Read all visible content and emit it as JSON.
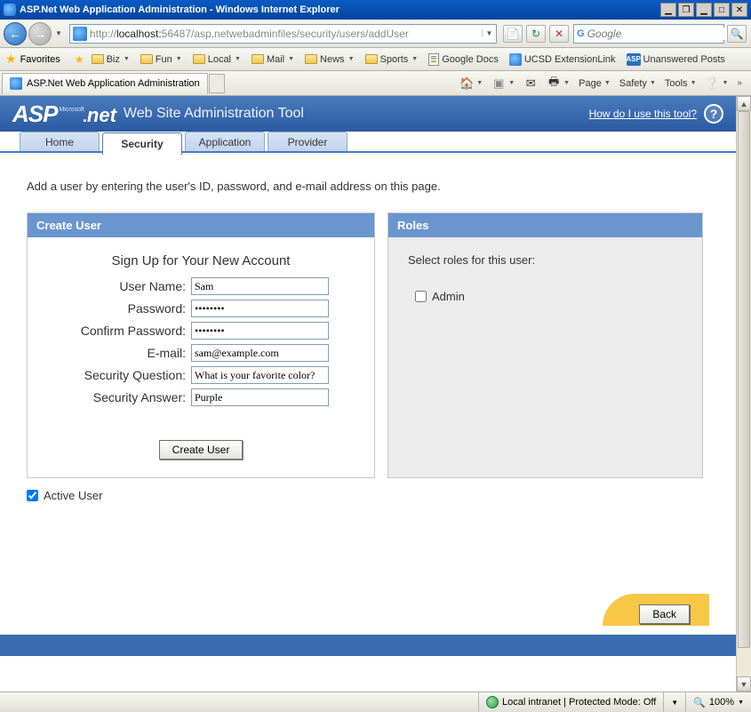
{
  "window": {
    "title": "ASP.Net Web Application Administration - Windows Internet Explorer"
  },
  "address": {
    "protocol": "http://",
    "host": "localhost:",
    "port": "56487",
    "path": "/asp.netwebadminfiles/security/users/addUser"
  },
  "search": {
    "placeholder": "Google"
  },
  "favorites": {
    "label": "Favorites",
    "items": [
      "Biz",
      "Fun",
      "Local",
      "Mail",
      "News",
      "Sports"
    ],
    "links": {
      "gdocs": "Google Docs",
      "ucsd": "UCSD ExtensionLink",
      "unanswered": "Unanswered Posts"
    }
  },
  "page_tab": "ASP.Net Web Application Administration",
  "commandbar": {
    "page": "Page",
    "safety": "Safety",
    "tools": "Tools"
  },
  "banner": {
    "logo_asp": "ASP",
    "logo_net": "net",
    "logo_micro": "Microsoft",
    "subtitle": "Web Site Administration Tool",
    "help": "How do I use this tool?"
  },
  "tabs": {
    "home": "Home",
    "security": "Security",
    "application": "Application",
    "provider": "Provider"
  },
  "instruction": "Add a user by entering the user's ID, password, and e-mail address on this page.",
  "create_user": {
    "header": "Create User",
    "title": "Sign Up for Your New Account",
    "labels": {
      "username": "User Name:",
      "password": "Password:",
      "confirm": "Confirm Password:",
      "email": "E-mail:",
      "question": "Security Question:",
      "answer": "Security Answer:"
    },
    "values": {
      "username": "Sam",
      "password": "••••••••",
      "confirm": "••••••••",
      "email": "sam@example.com",
      "question": "What is your favorite color?",
      "answer": "Purple"
    },
    "button": "Create User"
  },
  "roles": {
    "header": "Roles",
    "text": "Select roles for this user:",
    "items": [
      "Admin"
    ]
  },
  "active_user": "Active User",
  "back_button": "Back",
  "status": {
    "zone": "Local intranet | Protected Mode: Off",
    "zoom": "100%"
  }
}
